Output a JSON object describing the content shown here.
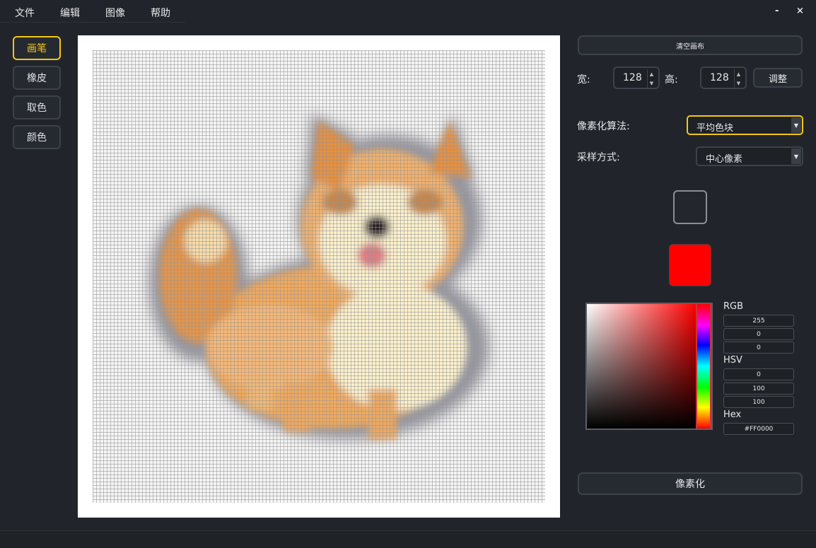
{
  "menu": {
    "items": [
      "文件",
      "编辑",
      "图像",
      "帮助"
    ],
    "minimize": "-",
    "close": "×"
  },
  "tools": [
    {
      "label": "画笔",
      "active": true
    },
    {
      "label": "橡皮",
      "active": false
    },
    {
      "label": "取色",
      "active": false
    },
    {
      "label": "颜色",
      "active": false
    }
  ],
  "right_panel": {
    "clear_canvas": "清空画布",
    "width_label": "宽:",
    "width_value": "128",
    "height_label": "高:",
    "height_value": "128",
    "adjust_button": "调整",
    "algorithm_label": "像素化算法:",
    "algorithm_value": "平均色块",
    "sampling_label": "采样方式:",
    "sampling_value": "中心像素",
    "pixelate_button": "像素化"
  },
  "color": {
    "current_color": "#ff0000",
    "rgb_label": "RGB",
    "rgb": [
      "255",
      "0",
      "0"
    ],
    "hsv_label": "HSV",
    "hsv": [
      "0",
      "100",
      "100"
    ],
    "hex_label": "Hex",
    "hex": "#FF0000"
  },
  "canvas": {
    "grid_width": 128,
    "grid_height": 128
  },
  "colors": {
    "accent": "#f5c518",
    "background": "#21252b",
    "border": "#3c424b"
  }
}
